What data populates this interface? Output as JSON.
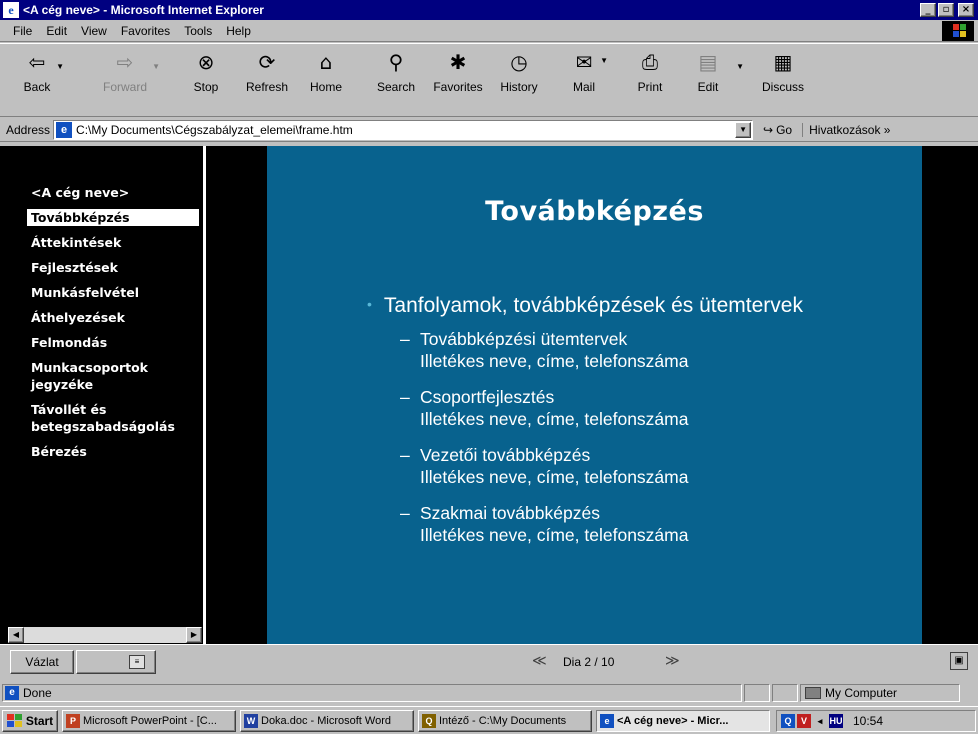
{
  "window": {
    "title": "<A cég neve> - Microsoft Internet Explorer",
    "min": "_",
    "max": "▫",
    "close": "×"
  },
  "menu": [
    "File",
    "Edit",
    "View",
    "Favorites",
    "Tools",
    "Help"
  ],
  "toolbar": {
    "back": "Back",
    "forward": "Forward",
    "stop": "Stop",
    "refresh": "Refresh",
    "home": "Home",
    "search": "Search",
    "favorites": "Favorites",
    "history": "History",
    "mail": "Mail",
    "print": "Print",
    "edit": "Edit",
    "discuss": "Discuss"
  },
  "address": {
    "label": "Address",
    "url": "C:\\My Documents\\Cégszabályzat_elemei\\frame.htm",
    "go": "Go",
    "links": "Hivatkozások »"
  },
  "outline": {
    "items": [
      "<A cég neve>",
      "Továbbképzés",
      "Áttekintések",
      "Fejlesztések",
      "Munkásfelvétel",
      "Áthelyezések",
      "Felmondás",
      "Munkacsoportok jegyzéke",
      "Távollét és betegszabadságolás",
      "Bérezés"
    ],
    "active_index": 1
  },
  "slide": {
    "title": "Továbbképzés",
    "bullet": "Tanfolyamok, továbbképzések és ütemtervek",
    "subs": [
      {
        "head": "Továbbképzési ütemtervek",
        "detail": "Illetékes neve, címe, telefonszáma"
      },
      {
        "head": "Csoportfejlesztés",
        "detail": "Illetékes neve, címe, telefonszáma"
      },
      {
        "head": "Vezetői továbbképzés",
        "detail": "Illetékes neve, címe, telefonszáma"
      },
      {
        "head": "Szakmai továbbképzés",
        "detail": "Illetékes neve, címe, telefonszáma"
      }
    ],
    "background_color": "#08628e"
  },
  "slidenav": {
    "outline_button": "Vázlat",
    "counter": "Dia 2 / 10"
  },
  "status": {
    "text": "Done",
    "zone": "My Computer"
  },
  "taskbar": {
    "start": "Start",
    "tasks": [
      {
        "label": "Microsoft PowerPoint - [C...",
        "icon_color": "#c04020"
      },
      {
        "label": "Doka.doc - Microsoft Word",
        "icon_color": "#2040a0"
      },
      {
        "label": "Intéző - C:\\My Documents",
        "icon_color": "#806000"
      },
      {
        "label": "<A cég neve> - Micr...",
        "icon_color": "#1050c0"
      }
    ],
    "language": "HU",
    "clock": "10:54"
  }
}
